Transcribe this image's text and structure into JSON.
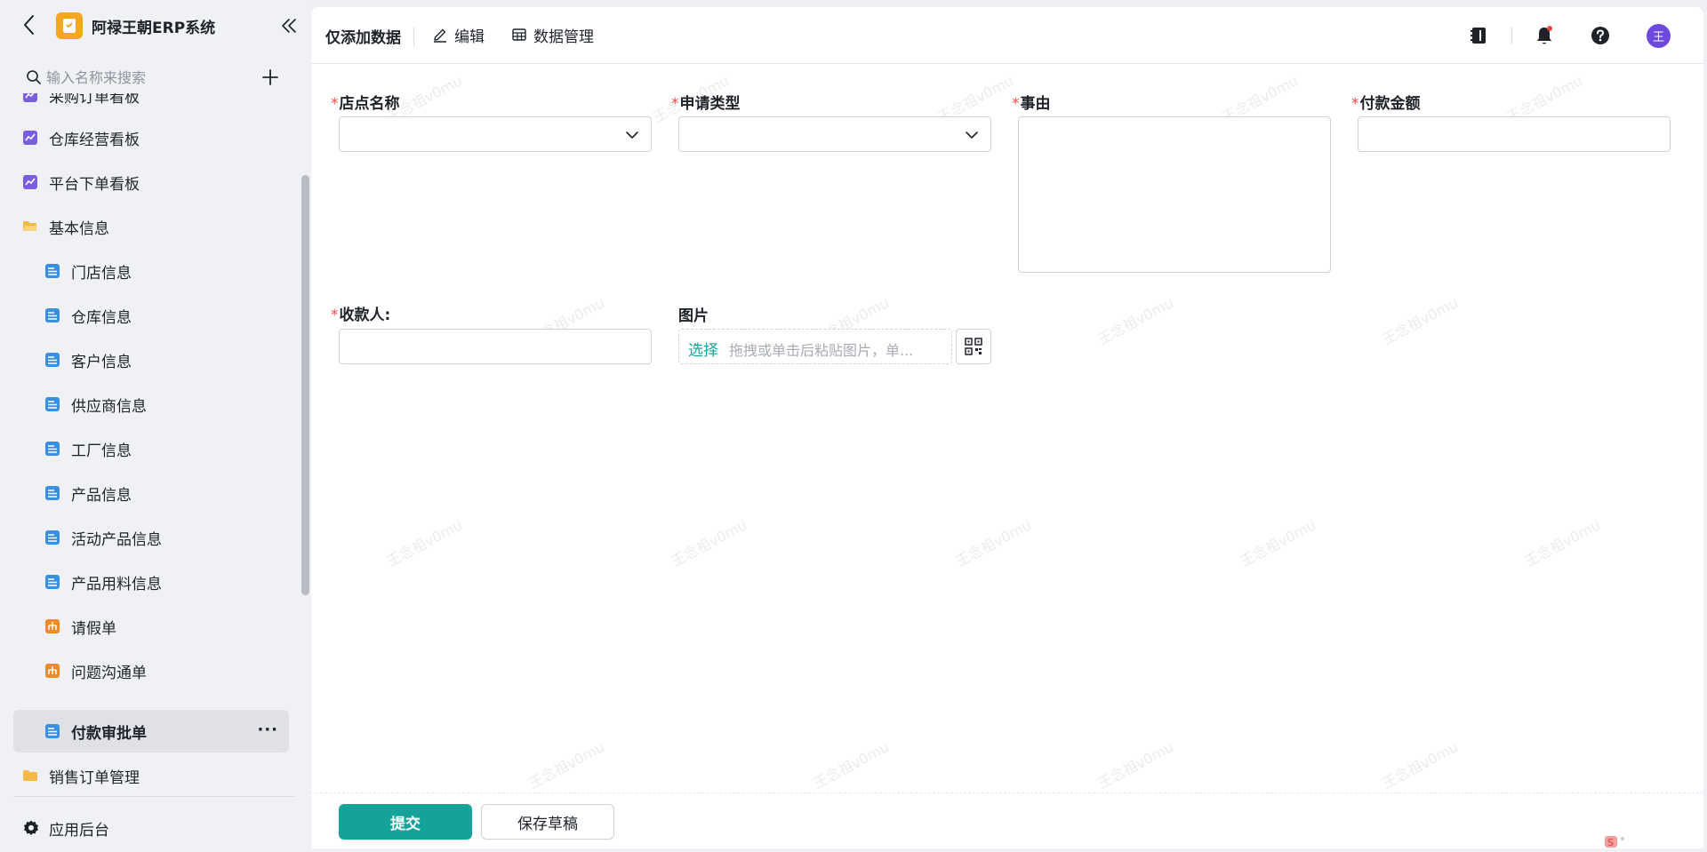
{
  "app": {
    "title": "阿禄王朝ERP系统"
  },
  "search": {
    "placeholder": "输入名称来搜索"
  },
  "sidebar": {
    "items": [
      {
        "label": "采购订单看板",
        "icon": "chart-dashboard-icon"
      },
      {
        "label": "仓库经营看板",
        "icon": "chart-dashboard-icon"
      },
      {
        "label": "平台下单看板",
        "icon": "chart-dashboard-icon"
      },
      {
        "label": "基本信息",
        "icon": "folder-open-icon"
      },
      {
        "label": "门店信息",
        "icon": "form-icon"
      },
      {
        "label": "仓库信息",
        "icon": "form-icon"
      },
      {
        "label": "客户信息",
        "icon": "form-icon"
      },
      {
        "label": "供应商信息",
        "icon": "form-icon"
      },
      {
        "label": "工厂信息",
        "icon": "form-icon"
      },
      {
        "label": "产品信息",
        "icon": "form-icon"
      },
      {
        "label": "活动产品信息",
        "icon": "form-icon"
      },
      {
        "label": "产品用料信息",
        "icon": "form-icon"
      },
      {
        "label": "请假单",
        "icon": "workflow-icon"
      },
      {
        "label": "问题沟通单",
        "icon": "workflow-icon"
      },
      {
        "label": "付款审批单",
        "icon": "form-icon",
        "active": true
      },
      {
        "label": "销售订单管理",
        "icon": "folder-icon"
      }
    ],
    "admin_label": "应用后台"
  },
  "toolbar": {
    "title": "仅添加数据",
    "edit_label": "编辑",
    "data_manage_label": "数据管理",
    "avatar_text": "王"
  },
  "form": {
    "store_name_label": "店点名称",
    "apply_type_label": "申请类型",
    "reason_label": "事由",
    "amount_label": "付款金额",
    "payee_label": "收款人:",
    "image_label": "图片",
    "upload_choose": "选择",
    "upload_hint": "拖拽或单击后粘贴图片，单...",
    "required_mark": "*"
  },
  "footer": {
    "submit_label": "提交",
    "draft_label": "保存草稿"
  },
  "watermark_text": "王念祖v0mu",
  "colors": {
    "accent": "#14a39a",
    "required": "#f54a45",
    "avatar": "#6f48e0",
    "logo": "#f5a623",
    "form_icon": "#3a8fe0",
    "dashboard_icon": "#7b5de0",
    "workflow_icon": "#f08a24",
    "folder_icon": "#f5b94a"
  }
}
